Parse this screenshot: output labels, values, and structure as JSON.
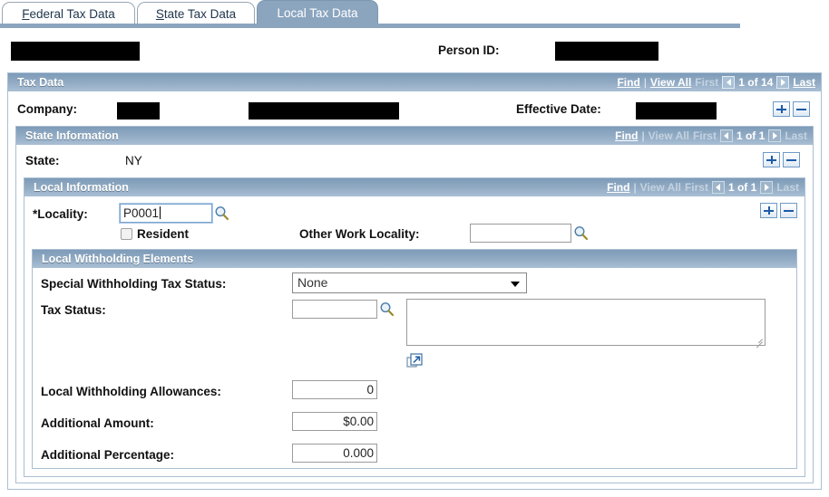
{
  "tabs": [
    {
      "label": "Federal Tax Data",
      "accel": "F",
      "rest": "ederal Tax Data",
      "active": false
    },
    {
      "label": "State Tax Data",
      "accel": "S",
      "rest": "tate Tax Data",
      "active": false
    },
    {
      "label": "Local Tax Data",
      "accel": "",
      "rest": "Local Tax Data",
      "active": true
    }
  ],
  "identity": {
    "person_id_label": "Person ID:",
    "name_value": "",
    "person_id_value": ""
  },
  "tax_data": {
    "title": "Tax Data",
    "pager": {
      "find": "Find",
      "separator": "|",
      "view_all": "View All",
      "first": "First",
      "count": "1 of 14",
      "last": "Last"
    },
    "company_label": "Company:",
    "company_code": "",
    "company_name": "",
    "effective_date_label": "Effective Date:",
    "effective_date_value": ""
  },
  "state_information": {
    "title": "State Information",
    "pager": {
      "find": "Find",
      "separator": "|",
      "view_all": "View All",
      "first": "First",
      "count": "1 of 1",
      "last": "Last"
    },
    "state_label": "State:",
    "state_value": "NY"
  },
  "local_information": {
    "title": "Local Information",
    "pager": {
      "find": "Find",
      "separator": "|",
      "view_all": "View All",
      "first": "First",
      "count": "1 of 1",
      "last": "Last"
    },
    "locality_label": "*Locality:",
    "locality_value": "P0001",
    "resident_label": "Resident",
    "resident_checked": false,
    "other_work_locality_label": "Other Work Locality:",
    "other_work_locality_value": ""
  },
  "local_withholding": {
    "title": "Local Withholding Elements",
    "special_withholding_label": "Special Withholding Tax Status:",
    "special_withholding_value": "None",
    "special_withholding_options": [
      "None"
    ],
    "tax_status_label": "Tax Status:",
    "tax_status_value": "",
    "tax_status_description": "",
    "allowances_label": "Local Withholding Allowances:",
    "allowances_value": "0",
    "additional_amount_label": "Additional Amount:",
    "additional_amount_value": "$0.00",
    "additional_percentage_label": "Additional Percentage:",
    "additional_percentage_value": "0.000"
  },
  "icons": {
    "lookup": "magnifier-icon",
    "expand": "expand-popout-icon",
    "prev": "prev-arrow-icon",
    "next": "next-arrow-icon"
  },
  "colors": {
    "header_bar": "#8ba5bf",
    "panel_border": "#a9bed2",
    "accent_blue": "#1d5ba6"
  }
}
